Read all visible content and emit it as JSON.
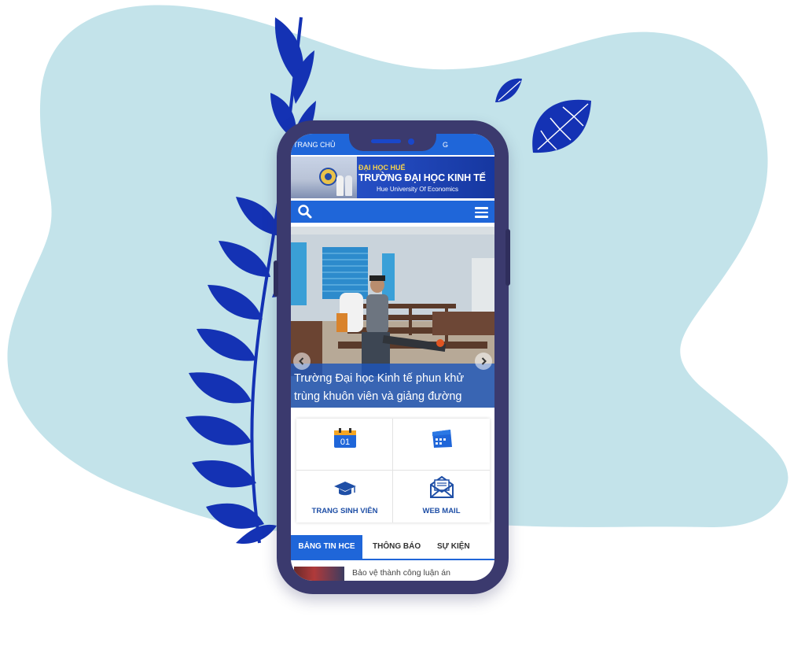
{
  "topnav": {
    "left_label": "TRANG CHỦ",
    "right_label": "G"
  },
  "banner": {
    "line1": "ĐẠI HỌC HUẾ",
    "line2": "TRƯỜNG ĐẠI HỌC KINH TẾ",
    "line3": "Hue University Of Economics"
  },
  "hero": {
    "caption": "Trường Đại học Kinh tế phun khử trùng khuôn viên và giảng đường"
  },
  "quick_links": [
    {
      "icon": "calendar-icon",
      "label": "",
      "day": "01"
    },
    {
      "icon": "schedule-icon",
      "label": ""
    },
    {
      "icon": "graduation-cap-icon",
      "label": "TRANG SINH VIÊN"
    },
    {
      "icon": "mail-icon",
      "label": "WEB MAIL"
    }
  ],
  "tabs": [
    {
      "label": "BẢNG TIN HCE",
      "active": true
    },
    {
      "label": "THÔNG BÁO",
      "active": false
    },
    {
      "label": "SỰ KIỆN",
      "active": false
    }
  ],
  "news": [
    {
      "title": "Bảo vệ thành công luận án"
    }
  ],
  "colors": {
    "blob": "#c3e3ea",
    "leaf": "#1432b4",
    "phone": "#3b3a6e",
    "brand_blue": "#1f66d9",
    "label_blue": "#1f4fa6"
  }
}
